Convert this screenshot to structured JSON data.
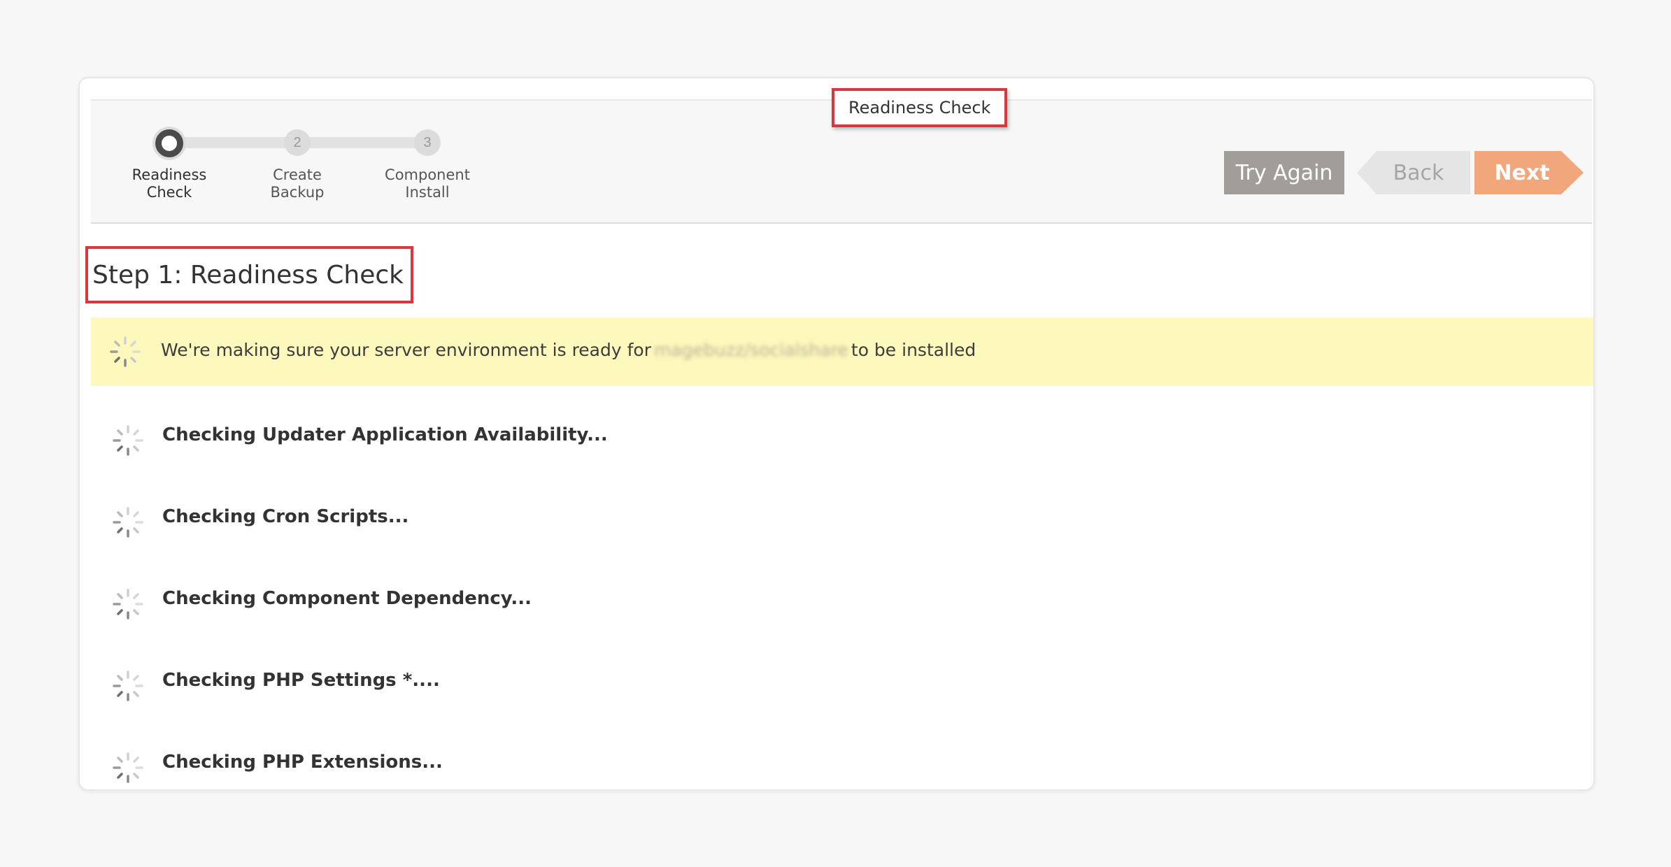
{
  "wizard": {
    "title": "Readiness Check",
    "steps": [
      {
        "number": "",
        "label_line1": "Readiness",
        "label_line2": "Check",
        "active": true
      },
      {
        "number": "2",
        "label_line1": "Create",
        "label_line2": "Backup",
        "active": false
      },
      {
        "number": "3",
        "label_line1": "Component",
        "label_line2": "Install",
        "active": false
      }
    ],
    "buttons": {
      "try_again": "Try Again",
      "back": "Back",
      "next": "Next"
    },
    "colors": {
      "next": "#f2a67c",
      "try_again": "#a19e9a",
      "highlight_border": "#d9363e",
      "notice_bg": "#fdf8bc"
    }
  },
  "main": {
    "step_title": "Step 1: Readiness Check",
    "notice": {
      "prefix": "We're making sure your server environment is ready for",
      "package": "magebuzz/socialshare",
      "suffix": "to be installed"
    },
    "checks": [
      {
        "label": "Checking Updater Application Availability..."
      },
      {
        "label": "Checking Cron Scripts..."
      },
      {
        "label": "Checking Component Dependency..."
      },
      {
        "label": "Checking PHP Settings *...."
      },
      {
        "label": "Checking PHP Extensions..."
      }
    ]
  }
}
